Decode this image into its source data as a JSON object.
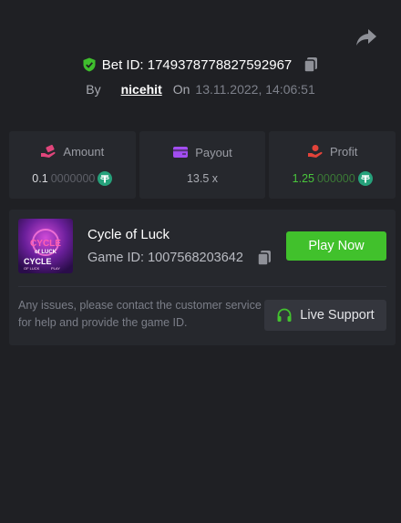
{
  "header": {
    "bet_id_label": "Bet ID: 1749378778827592967",
    "by_label": "By",
    "username": "nicehit",
    "on_label": "On",
    "datetime": "13.11.2022, 14:06:51"
  },
  "stats": {
    "amount": {
      "label": "Amount",
      "value_main": "0.1",
      "value_rest": "0000000",
      "icon": "hand-money-icon",
      "color": "#e0457b"
    },
    "payout": {
      "label": "Payout",
      "value": "13.5 x",
      "icon": "wallet-icon",
      "color": "#a24df0"
    },
    "profit": {
      "label": "Profit",
      "value_main": "1.25",
      "value_rest": "000000",
      "icon": "hand-coin-icon",
      "color": "#e2433a"
    }
  },
  "game": {
    "title": "Cycle of Luck",
    "game_id": "Game ID: 1007568203642",
    "play_label": "Play Now",
    "thumb_text_top": "CYCLE",
    "thumb_text_mid": "of LUCK",
    "thumb_text_big": "CYCLE",
    "thumb_text_small": "OF LUCK",
    "thumb_text_tag": "PLAY"
  },
  "support": {
    "text": "Any issues, please contact the customer service for help and provide the game ID.",
    "button_label": "Live Support"
  },
  "colors": {
    "accent_green": "#41c12c",
    "tether": "#26a17b",
    "background": "#1f2024",
    "card": "#26282d"
  }
}
